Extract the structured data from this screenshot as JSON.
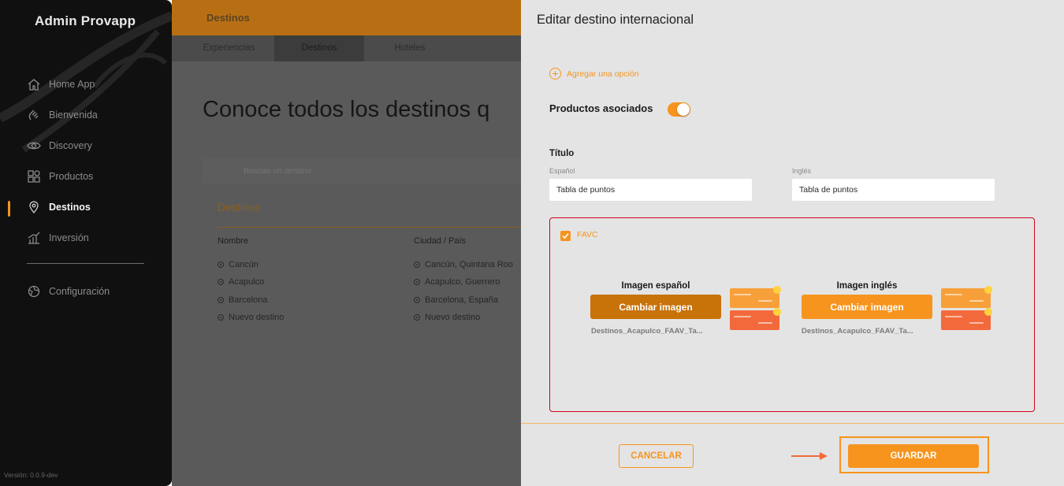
{
  "sidebar": {
    "brand": "Admin Provapp",
    "items": [
      {
        "label": "Home App",
        "icon": "home-icon"
      },
      {
        "label": "Bienvenida",
        "icon": "wave-hand-icon"
      },
      {
        "label": "Discovery",
        "icon": "eye-icon"
      },
      {
        "label": "Productos",
        "icon": "grid-icon"
      },
      {
        "label": "Destinos",
        "icon": "location-pin-icon",
        "active": true
      },
      {
        "label": "Inversión",
        "icon": "bar-chart-icon"
      },
      {
        "label": "Configuración",
        "icon": "gear-icon"
      }
    ],
    "version": "Versión: 0.0.9-dev"
  },
  "main": {
    "topbar_title": "Destinos",
    "tabs": [
      "Experiencias",
      "Destinos",
      "Hoteles"
    ],
    "active_tab": "Destinos",
    "heading": "Conoce todos los destinos q",
    "search_placeholder": "Buscas un destino",
    "section_title": "Destinos",
    "columns": [
      "Nombre",
      "Ciudad / País"
    ],
    "rows": [
      {
        "name": "Cancún",
        "city": "Cancún, Quintana Roo"
      },
      {
        "name": "Acapulco",
        "city": "Acapulco, Guerrero"
      },
      {
        "name": "Barcelona",
        "city": "Barcelona, España"
      },
      {
        "name": "Nuevo destino",
        "city": "Nuevo destino"
      }
    ]
  },
  "modal": {
    "title": "Editar destino internacional",
    "add_option": "Agregar una opción",
    "products_label": "Productos asociados",
    "products_toggle_on": true,
    "titulo_label": "Título",
    "spanish_label": "Español",
    "english_label": "Inglés",
    "spanish_value": "Tabla de puntos",
    "english_value": "Tabla de puntos",
    "favc_label": "FAVC",
    "favc_checked": true,
    "image_es_title": "Imagen español",
    "image_en_title": "Imagen inglés",
    "change_image_label": "Cambiar imagen",
    "file_es": "Destinos_Acapulco_FAAV_Ta...",
    "file_en": "Destinos_Acapulco_FAAV_Ta...",
    "cancel_label": "CANCELAR",
    "save_label": "GUARDAR"
  },
  "colors": {
    "accent": "#f7941d",
    "accent_dark": "#c8720a",
    "error_border": "#d0021b",
    "sidebar_bg": "#101010"
  }
}
